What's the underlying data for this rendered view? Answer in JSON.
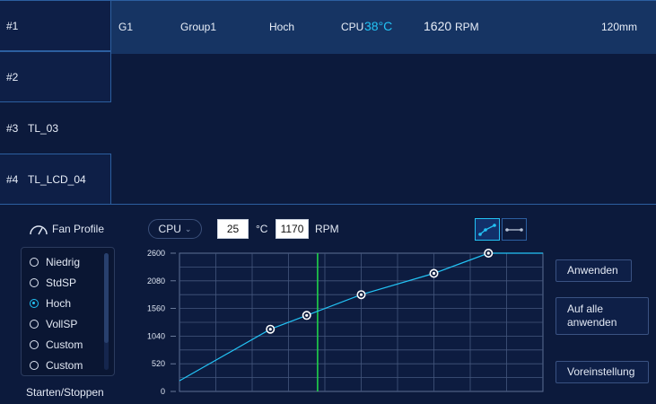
{
  "slots": [
    {
      "number": "#1",
      "name": ""
    },
    {
      "number": "#2",
      "name": ""
    },
    {
      "number": "#3",
      "name": "TL_03"
    },
    {
      "number": "#4",
      "name": "TL_LCD_04"
    }
  ],
  "fan_row": {
    "id": "G1",
    "group": "Group1",
    "profile": "Hoch",
    "temp_label": "CPU",
    "temp_value": "38°C",
    "rpm_value": "1620",
    "rpm_unit": "RPM",
    "size": "120mm"
  },
  "fan_profile": {
    "title": "Fan Profile",
    "options": [
      "Niedrig",
      "StdSP",
      "Hoch",
      "VollSP",
      "Custom",
      "Custom"
    ],
    "selected": "Hoch"
  },
  "start_stop_label": "Starten/Stoppen",
  "curve_editor": {
    "sensor": "CPU",
    "temp_input": "25",
    "temp_unit": "°C",
    "rpm_input": "1170",
    "rpm_unit": "RPM"
  },
  "buttons": {
    "apply": "Anwenden",
    "apply_all_line1": "Auf alle",
    "apply_all_line2": "anwenden",
    "default": "Voreinstellung"
  },
  "colors": {
    "background": "#0c1a3c",
    "accent": "#23c3f5",
    "current_temp_line": "#1fd14a",
    "selected_row": "#163463"
  },
  "chart_data": {
    "type": "line",
    "y_tick_labels": [
      "2600",
      "2080",
      "1560",
      "1040",
      "520",
      "0"
    ],
    "ylim": [
      0,
      2600
    ],
    "xlim": [
      0,
      100
    ],
    "grid": true,
    "current_temp": 38,
    "series": [
      {
        "x": [
          0,
          25,
          35,
          50,
          70,
          85,
          100
        ],
        "y": [
          200,
          1170,
          1430,
          1820,
          2220,
          2600,
          2600
        ],
        "markers": [
          false,
          true,
          true,
          true,
          true,
          true,
          false
        ]
      }
    ]
  }
}
